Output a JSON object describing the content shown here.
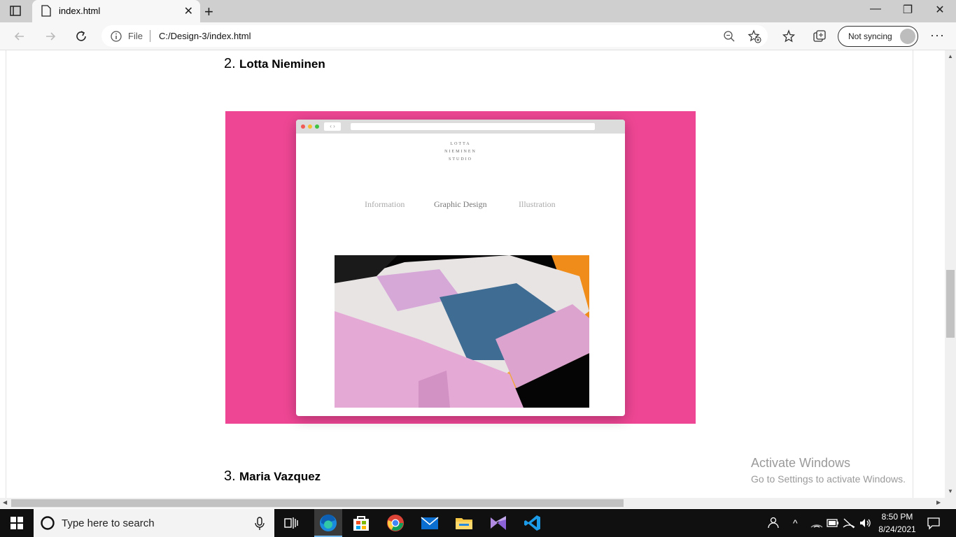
{
  "browser": {
    "tab_title": "index.html",
    "file_label": "File",
    "url": "C:/Design-3/index.html",
    "sync_label": "Not syncing",
    "more_label": "···",
    "new_tab": "+",
    "tab_close": "✕",
    "win_min": "—",
    "win_max": "❐",
    "win_close": "✕"
  },
  "page": {
    "item2_number": "2.",
    "item2_name": "Lotta Nieminen",
    "item3_number": "3.",
    "item3_name": "Maria Vazquez",
    "hero_color": "#ee4694",
    "mock": {
      "logo_line1": "LOTTA",
      "logo_line2": "NIEMINEN",
      "logo_line3": "STUDIO",
      "nav": [
        "Information",
        "Graphic Design",
        "Illustration"
      ],
      "nav_back": "‹ ›"
    }
  },
  "watermark": {
    "line1": "Activate Windows",
    "line2": "Go to Settings to activate Windows."
  },
  "taskbar": {
    "search_placeholder": "Type here to search",
    "time": "8:50 PM",
    "date": "8/24/2021",
    "apps": [
      "task-view-icon",
      "edge-icon",
      "store-icon",
      "chrome-icon",
      "mail-icon",
      "file-explorer-icon",
      "visual-studio-icon",
      "vscode-icon"
    ]
  }
}
